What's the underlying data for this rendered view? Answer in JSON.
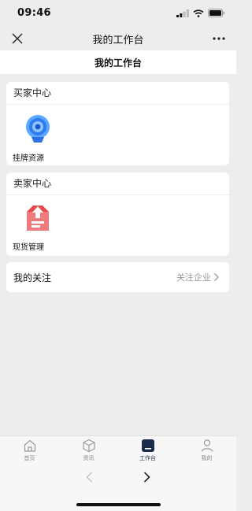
{
  "status": {
    "time": "09:46"
  },
  "titlebar": {
    "title": "我的工作台"
  },
  "header": {
    "title": "我的工作台"
  },
  "buyer": {
    "title": "买家中心",
    "items": [
      {
        "label": "挂牌资源",
        "icon": "radar-icon",
        "color": "#2f7bf0"
      }
    ]
  },
  "seller": {
    "title": "卖家中心",
    "items": [
      {
        "label": "现货管理",
        "icon": "inventory-box-icon",
        "color": "#ef5256"
      }
    ]
  },
  "follow": {
    "label": "我的关注",
    "link": "关注企业"
  },
  "tabs": [
    {
      "label": "首页",
      "icon": "home-icon",
      "active": false
    },
    {
      "label": "资讯",
      "icon": "cube-icon",
      "active": false
    },
    {
      "label": "工作台",
      "icon": "workbench-icon",
      "active": true
    },
    {
      "label": "我的",
      "icon": "user-icon",
      "active": false
    }
  ],
  "colors": {
    "accent": "#1b2b4a",
    "background": "#ededed"
  }
}
